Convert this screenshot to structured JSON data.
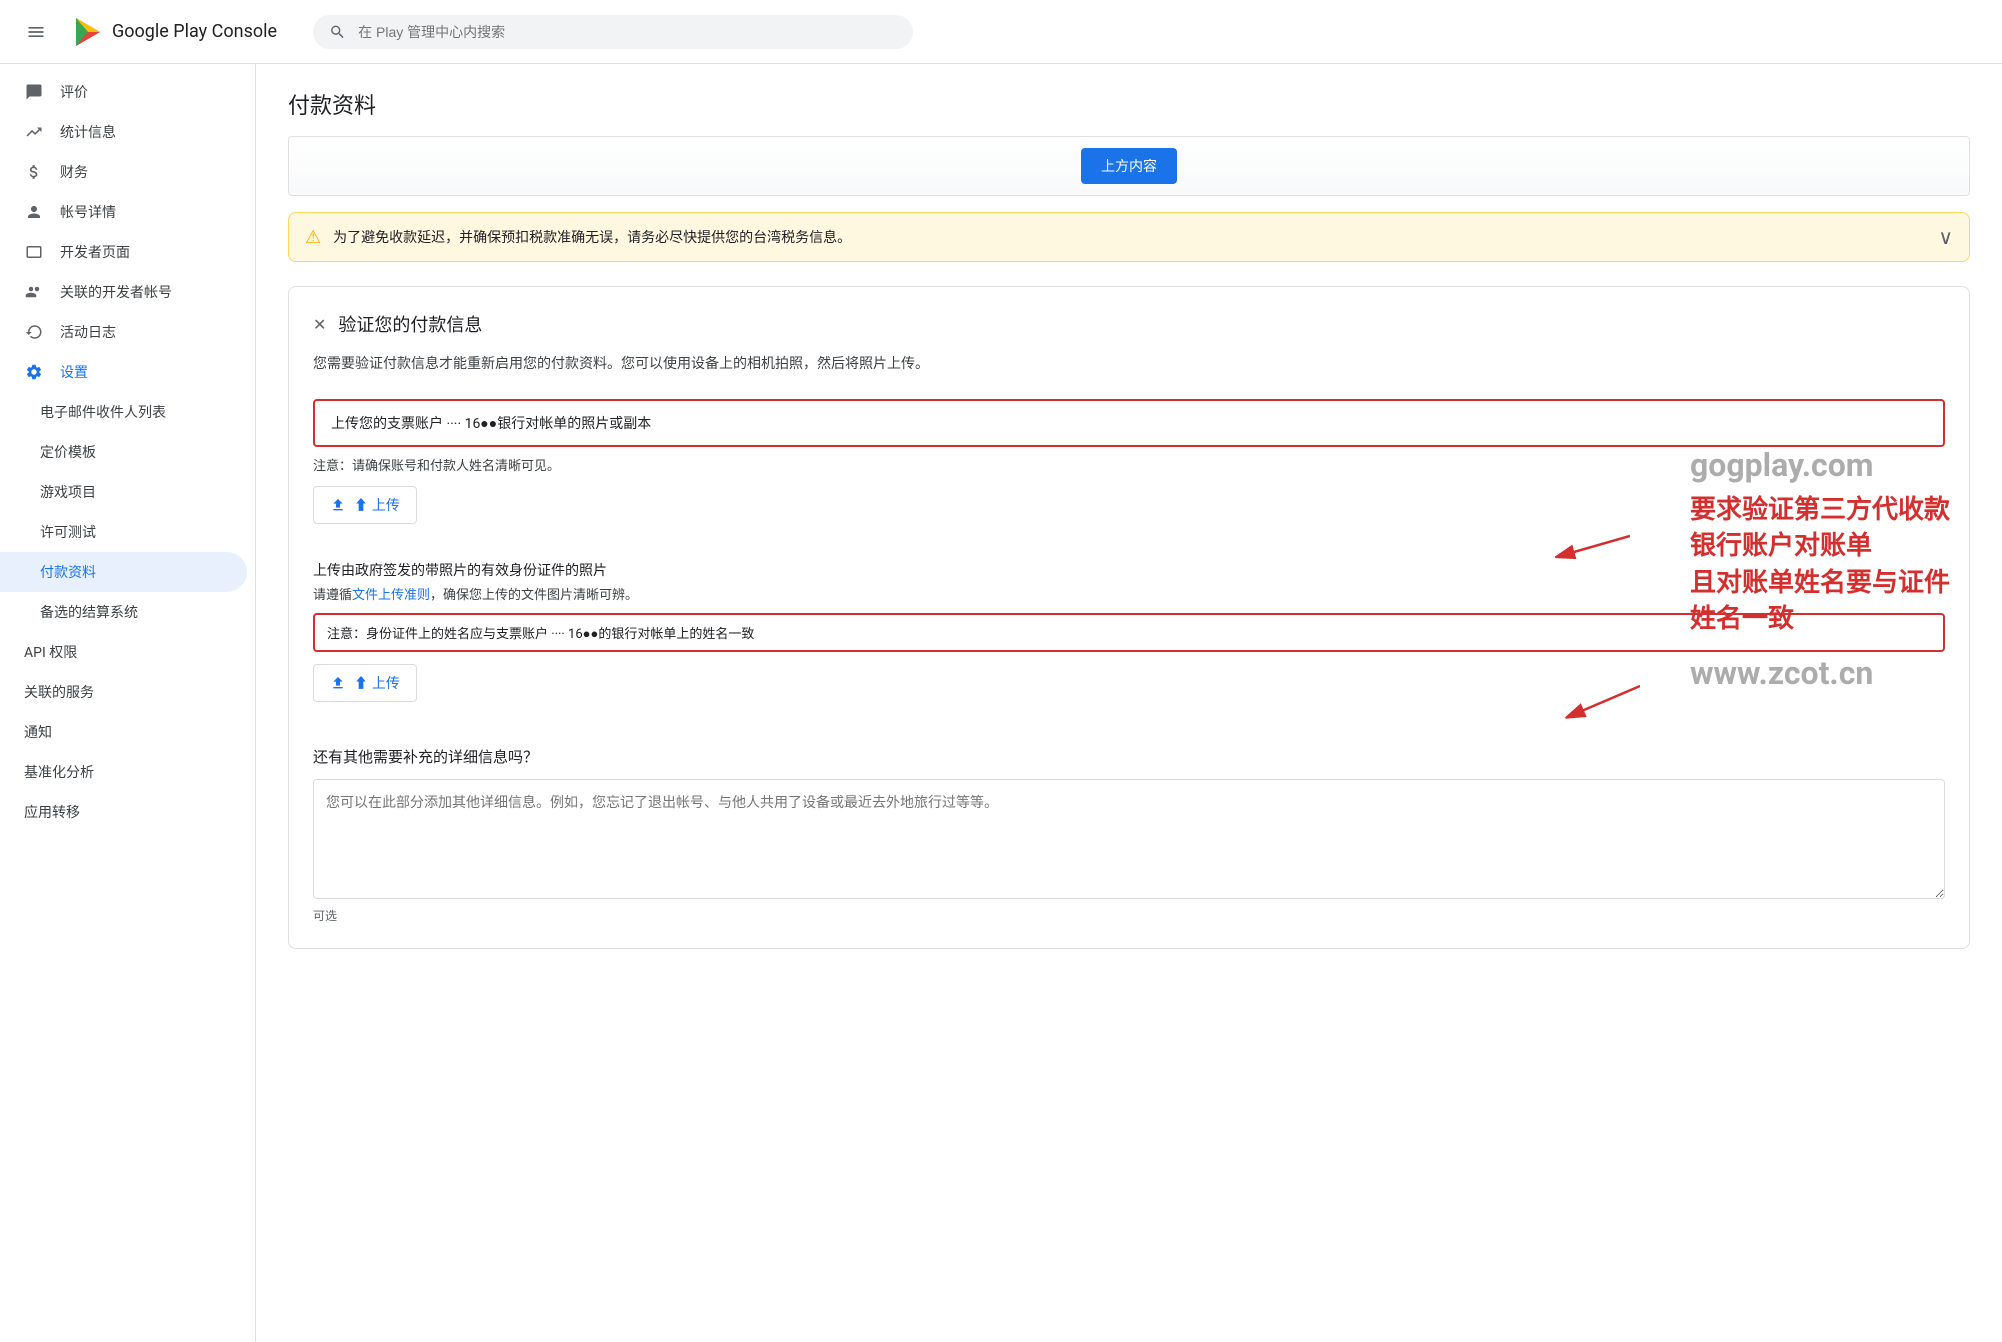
{
  "header": {
    "menu_icon": "☰",
    "logo_alt": "Google Play Console",
    "title": "Google Play Console",
    "search_placeholder": "在 Play 管理中心内搜索"
  },
  "sidebar": {
    "items": [
      {
        "id": "rating",
        "label": "评价",
        "icon": "★",
        "active": false
      },
      {
        "id": "stats",
        "label": "统计信息",
        "icon": "📊",
        "active": false
      },
      {
        "id": "finance",
        "label": "财务",
        "icon": "💰",
        "active": false
      },
      {
        "id": "account",
        "label": "帐号详情",
        "icon": "👤",
        "active": false
      },
      {
        "id": "devpage",
        "label": "开发者页面",
        "icon": "🖥",
        "active": false
      },
      {
        "id": "linked",
        "label": "关联的开发者帐号",
        "icon": "🔗",
        "active": false
      },
      {
        "id": "activity",
        "label": "活动日志",
        "icon": "📋",
        "active": false
      },
      {
        "id": "settings",
        "label": "设置",
        "icon": "⚙",
        "active": false
      },
      {
        "id": "email-list",
        "label": "电子邮件收件人列表",
        "icon": "",
        "active": false
      },
      {
        "id": "pricing",
        "label": "定价模板",
        "icon": "",
        "active": false
      },
      {
        "id": "games",
        "label": "游戏项目",
        "icon": "",
        "active": false
      },
      {
        "id": "license",
        "label": "许可测试",
        "icon": "",
        "active": false
      },
      {
        "id": "payment",
        "label": "付款资料",
        "icon": "",
        "active": true
      },
      {
        "id": "billing",
        "label": "备选的结算系统",
        "icon": "",
        "active": false
      },
      {
        "id": "api",
        "label": "API 权限",
        "icon": "",
        "active": false
      },
      {
        "id": "related",
        "label": "关联的服务",
        "icon": "",
        "active": false
      },
      {
        "id": "notify",
        "label": "通知",
        "icon": "",
        "active": false
      },
      {
        "id": "analytics",
        "label": "基准化分析",
        "icon": "",
        "active": false
      },
      {
        "id": "transfer",
        "label": "应用转移",
        "icon": "",
        "active": false
      }
    ]
  },
  "main": {
    "page_title": "付款资料",
    "warning": {
      "icon": "⚠",
      "text": "为了避免收款延迟，并确保预扣税款准确无误，请务必尽快提供您的台湾税务信息。",
      "expand_icon": "∨"
    },
    "verify": {
      "close_icon": "✕",
      "title": "验证您的付款信息",
      "description": "您需要验证付款信息才能重新启用您的付款资料。您可以使用设备上的相机拍照，然后将照片上传。",
      "bank_upload": {
        "label": "上传您的支票账户 ···· 16●●银行对帐单的照片或副本",
        "note": "注意：请确保账号和付款人姓名清晰可见。",
        "btn": "⬆ 上传"
      },
      "id_upload": {
        "title": "上传由政府签发的带照片的有效身份证件的照片",
        "link_text": "文件上传准则",
        "link_note": "请遵循文件上传准则，确保您上传的文件图片清晰可辨。",
        "note_red": "注意：身份证件上的姓名应与支票账户 ···· 16●●的银行对帐单上的姓名一致",
        "btn": "⬆ 上传"
      }
    },
    "additional": {
      "title": "还有其他需要补充的详细信息吗？",
      "placeholder": "您可以在此部分添加其他详细信息。例如，您忘记了退出帐号、与他人共用了设备或最近去外地旅行过等等。",
      "optional": "可选"
    },
    "annotation": {
      "line1": "要求验证第三方代收款",
      "line2": "银行账户对账单",
      "line3": "且对账单姓名要与证件",
      "line4": "姓名一致",
      "watermark1": "gogplay.com",
      "watermark2": "www.zcot.cn"
    }
  }
}
